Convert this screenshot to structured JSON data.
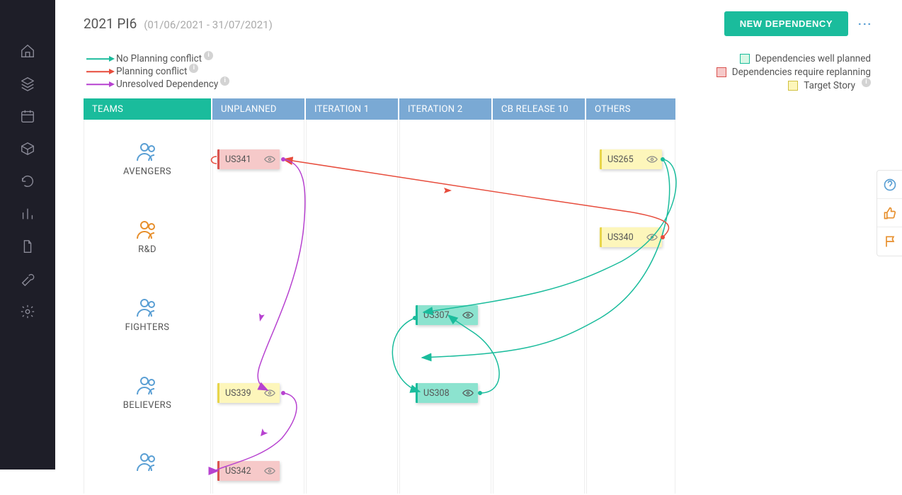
{
  "header": {
    "title": "2021 PI6",
    "dates": "(01/06/2021 - 31/07/2021)",
    "newButton": "NEW DEPENDENCY"
  },
  "legendLeft": [
    {
      "label": "No Planning conflict",
      "color": "#1abc9c"
    },
    {
      "label": "Planning conflict",
      "color": "#e74c3c"
    },
    {
      "label": "Unresolved Dependency",
      "color": "#b742d0"
    }
  ],
  "legendRight": [
    {
      "label": "Dependencies well planned",
      "fill": "#d9f7e6",
      "border": "#1abc9c"
    },
    {
      "label": "Dependencies require replanning",
      "fill": "#f6c9c9",
      "border": "#d9534f"
    },
    {
      "label": "Target Story",
      "fill": "#fdf6bb",
      "border": "#d0c040",
      "info": true
    }
  ],
  "columns": [
    {
      "key": "teams",
      "label": "TEAMS"
    },
    {
      "key": "unplanned",
      "label": "UNPLANNED"
    },
    {
      "key": "iter1",
      "label": "ITERATION 1"
    },
    {
      "key": "iter2",
      "label": "ITERATION 2"
    },
    {
      "key": "cb10",
      "label": "CB RELEASE 10"
    },
    {
      "key": "others",
      "label": "OTHERS"
    }
  ],
  "teams": [
    {
      "key": "avengers",
      "label": "AVENGERS",
      "color": "#5a9fd4"
    },
    {
      "key": "rnd",
      "label": "R&D",
      "color": "#e78f2c"
    },
    {
      "key": "fighters",
      "label": "FIGHTERS",
      "color": "#5a9fd4"
    },
    {
      "key": "believers",
      "label": "BELIEVERS",
      "color": "#5a9fd4"
    },
    {
      "key": "team5",
      "label": "",
      "color": "#5a9fd4"
    }
  ],
  "cards": {
    "us341": "US341",
    "us265": "US265",
    "us340": "US340",
    "us339": "US339",
    "us307": "US307",
    "us308": "US308",
    "us342": "US342"
  }
}
